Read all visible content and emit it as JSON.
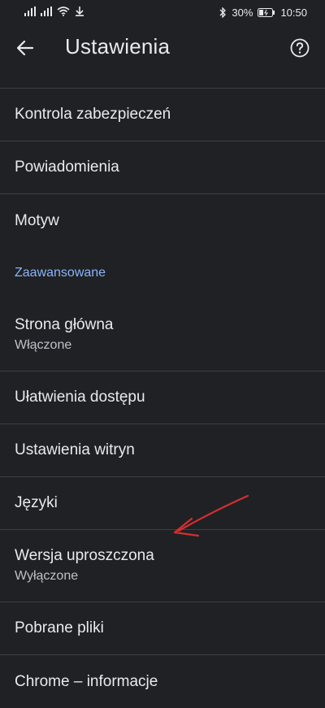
{
  "status_bar": {
    "battery": "30%",
    "time": "10:50"
  },
  "header": {
    "title": "Ustawienia",
    "back_icon": "arrow-back-icon",
    "help_icon": "help-circle-icon"
  },
  "items": {
    "safety_check": {
      "title": "Kontrola zabezpieczeń"
    },
    "notifications": {
      "title": "Powiadomienia"
    },
    "theme": {
      "title": "Motyw"
    },
    "advanced_header": "Zaawansowane",
    "homepage": {
      "title": "Strona główna",
      "subtitle": "Włączone"
    },
    "accessibility": {
      "title": "Ułatwienia dostępu"
    },
    "site_settings": {
      "title": "Ustawienia witryn"
    },
    "languages": {
      "title": "Języki"
    },
    "lite_mode": {
      "title": "Wersja uproszczona",
      "subtitle": "Wyłączone"
    },
    "downloads": {
      "title": "Pobrane pliki"
    },
    "about_chrome": {
      "title": "Chrome – informacje"
    }
  },
  "colors": {
    "background": "#202124",
    "divider": "#3c4043",
    "accent": "#8ab4f8",
    "annotation_arrow": "#d32f2f"
  }
}
